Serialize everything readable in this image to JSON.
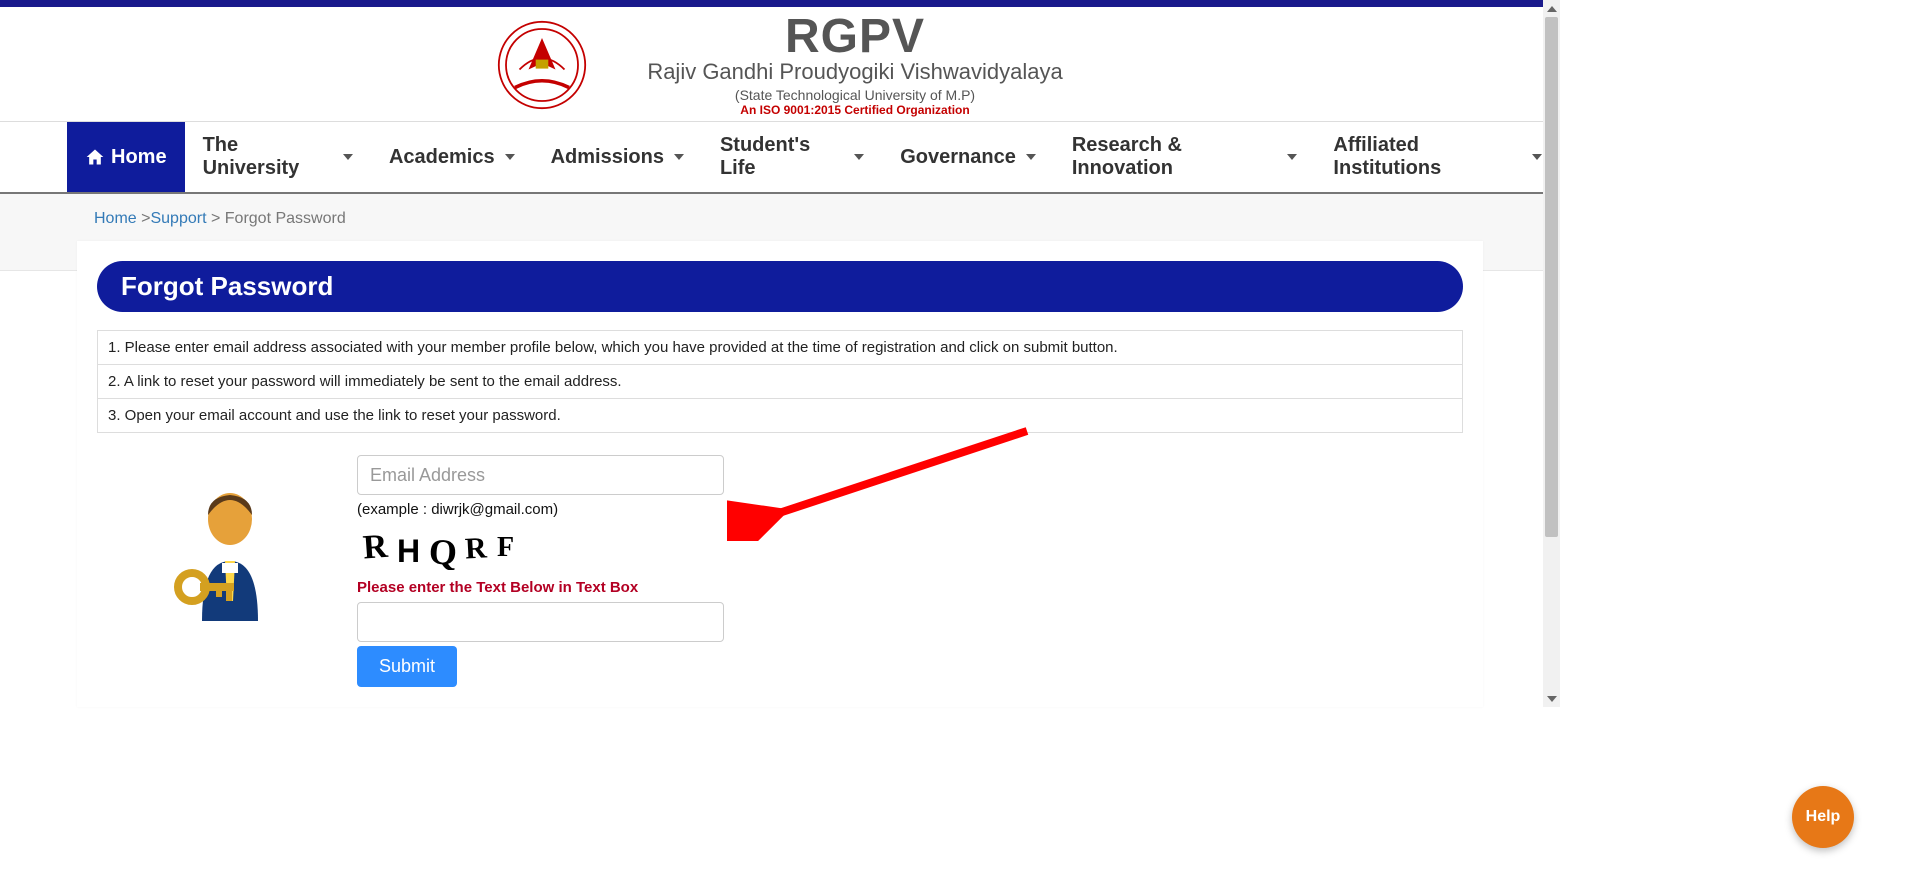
{
  "brand": {
    "main": "RGPV",
    "sub": "Rajiv Gandhi Proudyogiki Vishwavidyalaya",
    "sub2": "(State Technological University of M.P)",
    "cert": "An ISO 9001:2015 Certified Organization"
  },
  "nav": {
    "home": "Home",
    "items": [
      "The University",
      "Academics",
      "Admissions",
      "Student's Life",
      "Governance",
      "Research & Innovation",
      "Affiliated Institutions"
    ]
  },
  "breadcrumb": {
    "home": "Home",
    "support": "Support",
    "current": "Forgot Password"
  },
  "page": {
    "title": "Forgot Password",
    "instructions": [
      "1. Please enter  email address associated with your member profile below, which you have provided at the time of registration and click on submit button.",
      "2. A link to reset your password will immediately be sent to the email address.",
      "3. Open your email account and use the link to reset your password."
    ]
  },
  "form": {
    "email_placeholder": "Email Address",
    "email_value": "",
    "example": "(example : diwrjk@gmail.com)",
    "captcha_text": "RHQRF",
    "captcha_label": "Please enter the Text Below in Text Box",
    "captcha_value": "",
    "submit": "Submit"
  },
  "help": {
    "label": "Help"
  }
}
